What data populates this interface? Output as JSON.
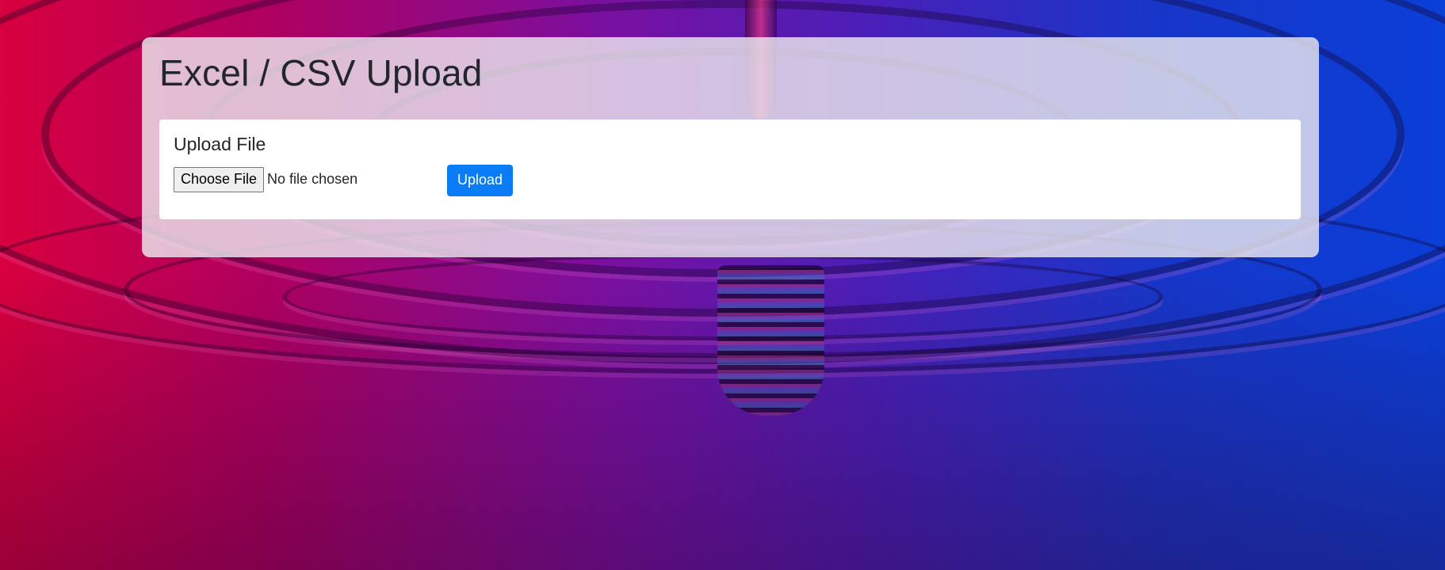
{
  "page": {
    "title": "Excel / CSV Upload"
  },
  "upload_card": {
    "title": "Upload File",
    "choose_file_label": "Choose File",
    "file_status": "No file chosen",
    "upload_label": "Upload"
  },
  "colors": {
    "upload_button": "#0a7cf5",
    "panel_background": "rgba(235,232,238,0.82)",
    "text": "#23262b"
  }
}
